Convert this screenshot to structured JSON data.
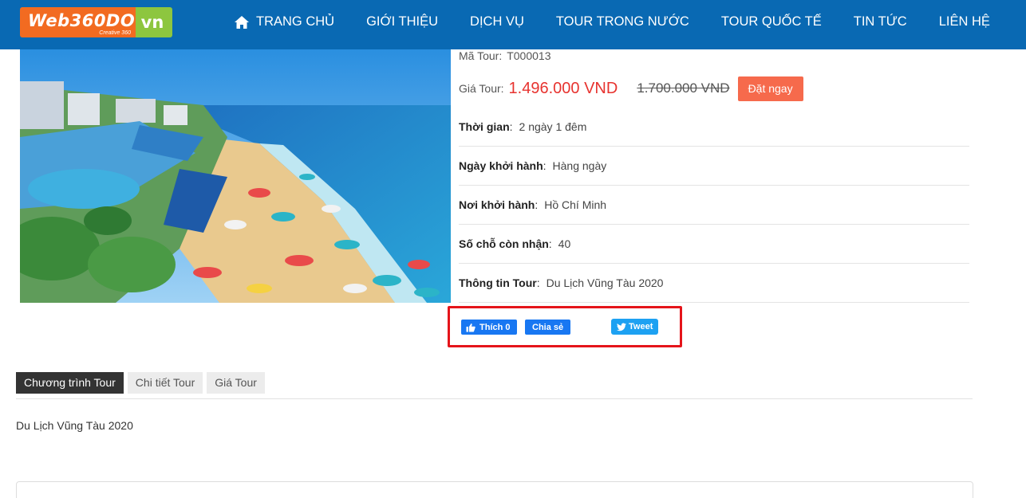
{
  "header": {
    "logo": {
      "main": "Web360DO",
      "sub": "Creative 360",
      "tld": "vn"
    },
    "nav": [
      {
        "label": "TRANG CHỦ",
        "icon": "home-icon"
      },
      {
        "label": "GIỚI THIỆU"
      },
      {
        "label": "DỊCH VỤ"
      },
      {
        "label": "TOUR TRONG NƯỚC"
      },
      {
        "label": "TOUR QUỐC TẾ"
      },
      {
        "label": "TIN TỨC"
      },
      {
        "label": "LIÊN HỆ"
      }
    ]
  },
  "tour": {
    "code_label": "Mã Tour:",
    "code": "T000013",
    "price_label": "Giá Tour:",
    "price_new": "1.496.000 VND",
    "price_old": "1.700.000 VND",
    "book_label": "Đặt ngay",
    "details": [
      {
        "label": "Thời gian",
        "value": "2 ngày 1 đêm"
      },
      {
        "label": "Ngày khởi hành",
        "value": "Hàng ngày"
      },
      {
        "label": "Nơi khởi hành",
        "value": "Hồ Chí Minh"
      },
      {
        "label": "Số chỗ còn nhận",
        "value": "40"
      },
      {
        "label": "Thông tin Tour",
        "value": "Du Lịch Vũng Tàu 2020"
      }
    ]
  },
  "social": {
    "like_label": "Thích 0",
    "share_label": "Chia sẻ",
    "tweet_label": "Tweet"
  },
  "tabs": [
    {
      "label": "Chương trình Tour",
      "active": true
    },
    {
      "label": "Chi tiết Tour",
      "active": false
    },
    {
      "label": "Giá Tour",
      "active": false
    }
  ],
  "tab_content": "Du Lịch Vũng Tàu 2020",
  "colors": {
    "header_bg": "#0969b3",
    "logo_orange": "#f26b21",
    "logo_green": "#8dc63f",
    "price_red": "#e7332f",
    "book_button": "#f66a4c",
    "highlight_border": "#e5141a",
    "facebook": "#1877f2",
    "twitter": "#1da1f2"
  }
}
